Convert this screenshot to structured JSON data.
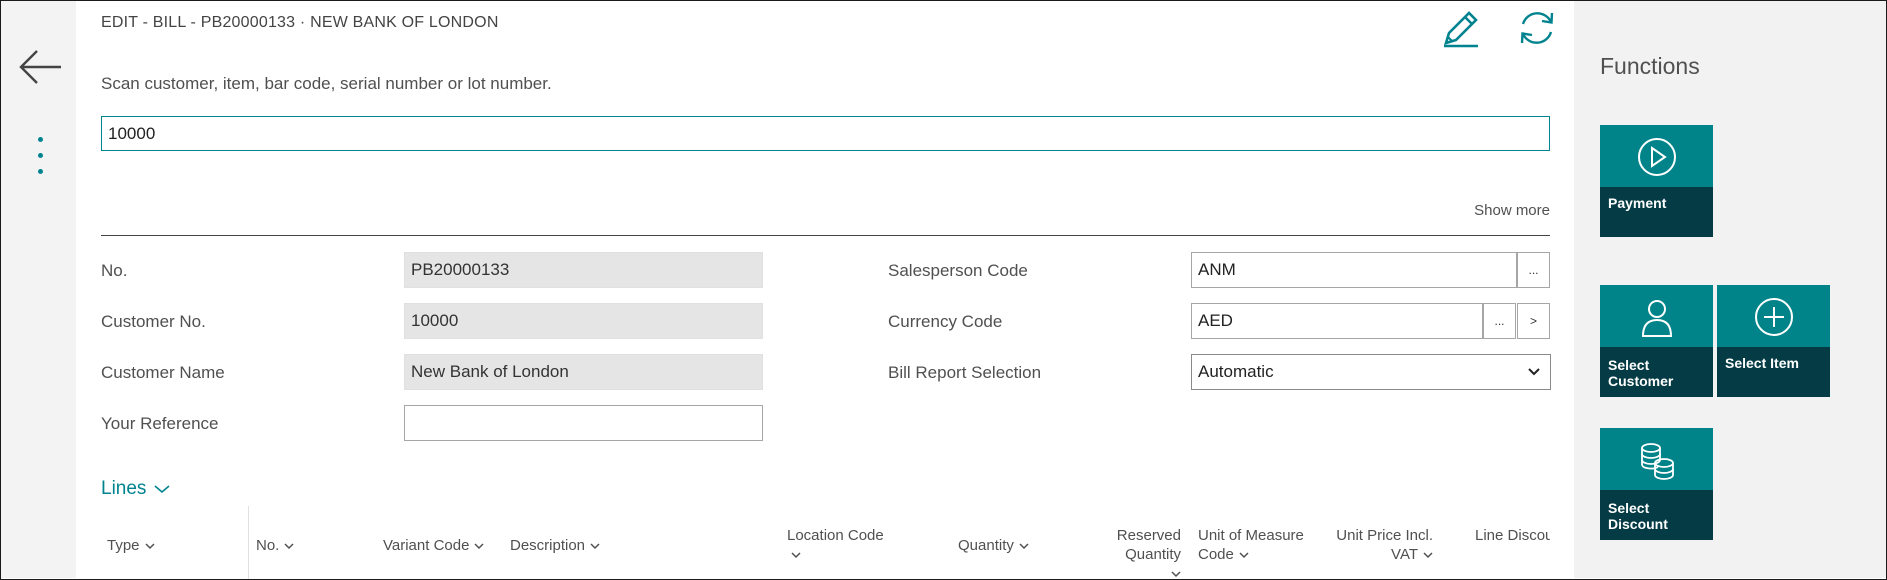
{
  "header": {
    "caption": "EDIT - BILL - PB20000133 · NEW BANK OF LONDON"
  },
  "toolbar": {
    "edit_icon": "pencil-icon",
    "refresh_icon": "refresh-icon"
  },
  "scan": {
    "label": "Scan customer, item, bar code, serial number or lot number.",
    "value": "10000"
  },
  "show_more": "Show more",
  "fields": {
    "no": {
      "label": "No.",
      "value": "PB20000133"
    },
    "customer_no": {
      "label": "Customer No.",
      "value": "10000"
    },
    "customer_name": {
      "label": "Customer Name",
      "value": "New Bank of London"
    },
    "your_reference": {
      "label": "Your Reference",
      "value": ""
    },
    "salesperson_code": {
      "label": "Salesperson Code",
      "value": "ANM",
      "lookup": "..."
    },
    "currency_code": {
      "label": "Currency Code",
      "value": "AED",
      "lookup": "...",
      "drill": ">"
    },
    "bill_report_selection": {
      "label": "Bill Report Selection",
      "value": "Automatic"
    }
  },
  "lines": {
    "title": "Lines",
    "columns": [
      {
        "l1": "Type",
        "l2": ""
      },
      {
        "l1": "No.",
        "l2": ""
      },
      {
        "l1": "Variant Code",
        "l2": ""
      },
      {
        "l1": "Description",
        "l2": ""
      },
      {
        "l1": "Location Code",
        "l2": ""
      },
      {
        "l1": "Quantity",
        "l2": ""
      },
      {
        "l1": "Reserved Quantity",
        "l2": ""
      },
      {
        "l1": "Unit of Measure",
        "l2": "Code"
      },
      {
        "l1": "Unit Price Incl.",
        "l2": "VAT"
      },
      {
        "l1": "Line Discou",
        "l2": ""
      }
    ]
  },
  "functions": {
    "title": "Functions",
    "tiles": [
      {
        "label": "Payment",
        "icon": "play-circle-icon"
      },
      {
        "label": "Select Customer",
        "icon": "person-icon"
      },
      {
        "label": "Select Item",
        "icon": "plus-circle-icon"
      },
      {
        "label": "Select Discount",
        "icon": "coins-icon"
      }
    ]
  },
  "colors": {
    "accent": "#008489",
    "tile_dark": "#053b44",
    "link": "#00838f"
  }
}
